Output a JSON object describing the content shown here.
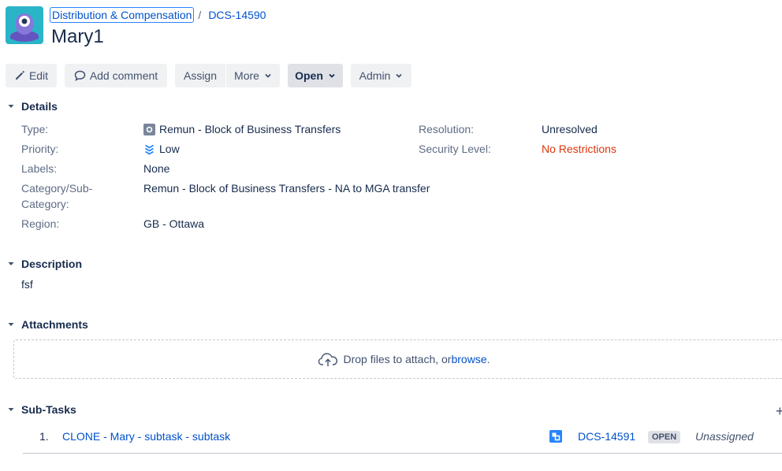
{
  "breadcrumb": {
    "project": "Distribution & Compensation",
    "separator": "/",
    "issue_key": "DCS-14590"
  },
  "issue": {
    "summary": "Mary1"
  },
  "toolbar": {
    "edit": "Edit",
    "add_comment": "Add comment",
    "assign": "Assign",
    "more": "More",
    "status": "Open",
    "admin": "Admin"
  },
  "details": {
    "heading": "Details",
    "type_label": "Type:",
    "type_value": "Remun - Block of Business Transfers",
    "priority_label": "Priority:",
    "priority_value": "Low",
    "labels_label": "Labels:",
    "labels_value": "None",
    "category_label_1": "Category/Sub-",
    "category_label_2": "Category:",
    "category_value": "Remun - Block of Business Transfers - NA to MGA transfer",
    "region_label": "Region:",
    "region_value": "GB - Ottawa",
    "resolution_label": "Resolution:",
    "resolution_value": "Unresolved",
    "security_label": "Security Level:",
    "security_value": "No Restrictions"
  },
  "description": {
    "heading": "Description",
    "text": "fsf"
  },
  "attachments": {
    "heading": "Attachments",
    "drop_text": "Drop files to attach, or ",
    "browse": "browse",
    "period": "."
  },
  "subtasks": {
    "heading": "Sub-Tasks",
    "add_symbol": "+",
    "items": [
      {
        "index": "1.",
        "summary": "CLONE - Mary - subtask - subtask",
        "key": "DCS-14591",
        "status": "OPEN",
        "assignee": "Unassigned"
      }
    ]
  },
  "colors": {
    "link": "#0052cc",
    "danger": "#de350b",
    "avatar_bg": "#2ab4c8"
  }
}
